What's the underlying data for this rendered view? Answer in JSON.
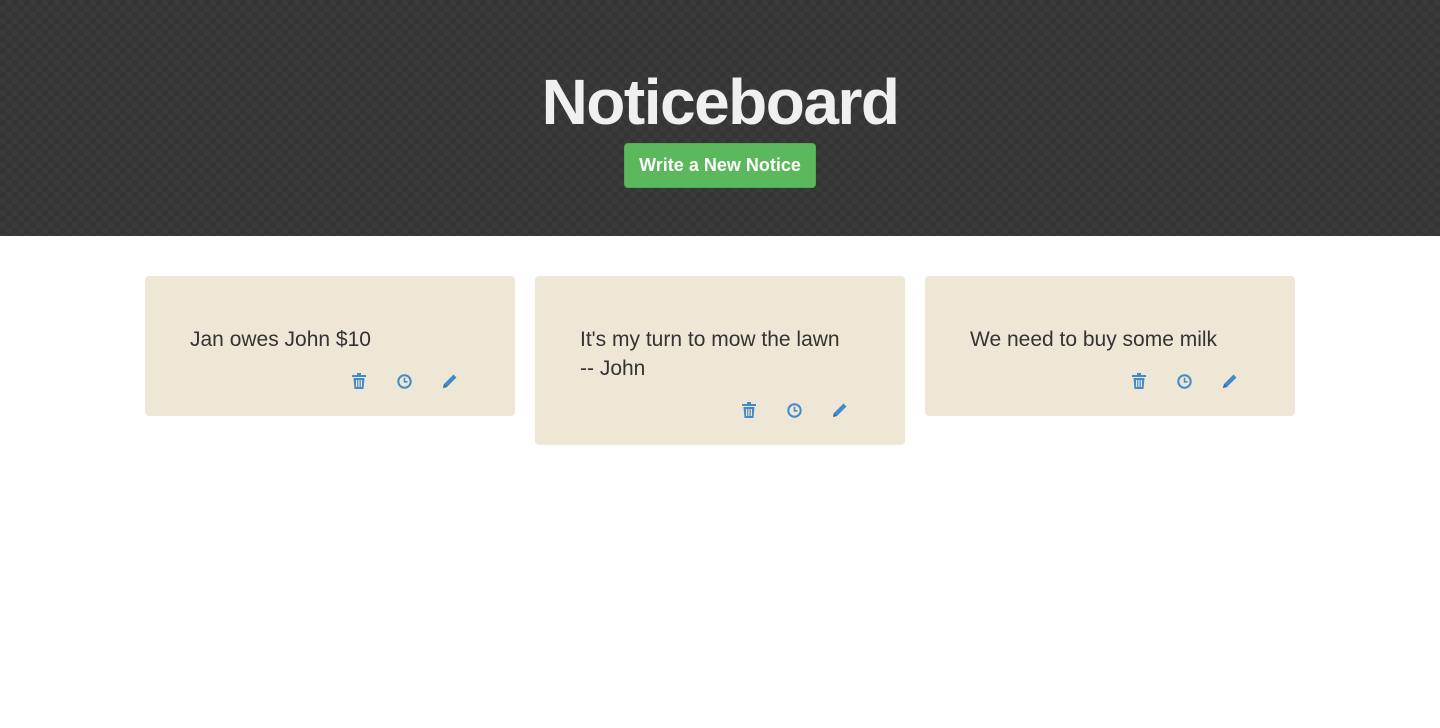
{
  "header": {
    "title": "Noticeboard",
    "new_notice_label": "Write a New Notice"
  },
  "colors": {
    "header_bg": "#353535",
    "button_green": "#5cb85c",
    "notice_bg": "#efe7d5",
    "icon_blue": "#428bca"
  },
  "notices": [
    {
      "text": "Jan owes John $10",
      "actions": [
        "trash-icon",
        "clock-icon",
        "pencil-icon"
      ]
    },
    {
      "text": "It's my turn to mow the lawn\n-- John",
      "actions": [
        "trash-icon",
        "clock-icon",
        "pencil-icon"
      ]
    },
    {
      "text": "We need to buy some milk",
      "actions": [
        "trash-icon",
        "clock-icon",
        "pencil-icon"
      ]
    }
  ]
}
